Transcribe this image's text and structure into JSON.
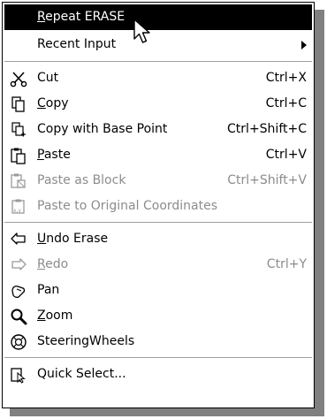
{
  "menu": {
    "repeat": {
      "label": "Repeat ERASE"
    },
    "recent_input": {
      "label": "Recent Input"
    },
    "cut": {
      "label": "Cut",
      "shortcut": "Ctrl+X",
      "icon": "scissors-icon"
    },
    "copy": {
      "label": "Copy",
      "shortcut": "Ctrl+C",
      "icon": "copy-icon"
    },
    "copy_base": {
      "label": "Copy with Base Point",
      "shortcut": "Ctrl+Shift+C",
      "icon": "copy-base-point-icon"
    },
    "paste": {
      "label": "Paste",
      "shortcut": "Ctrl+V",
      "icon": "paste-icon"
    },
    "paste_block": {
      "label": "Paste as Block",
      "shortcut": "Ctrl+Shift+V",
      "icon": "paste-block-icon"
    },
    "paste_orig": {
      "label": "Paste to Original Coordinates",
      "icon": "paste-coordinates-icon"
    },
    "undo": {
      "label": "Undo Erase",
      "icon": "undo-icon"
    },
    "redo": {
      "label": "Redo",
      "shortcut": "Ctrl+Y",
      "icon": "redo-icon"
    },
    "pan": {
      "label": "Pan",
      "icon": "pan-hand-icon"
    },
    "zoom": {
      "label": "Zoom",
      "icon": "zoom-icon"
    },
    "steering": {
      "label": "SteeringWheels",
      "icon": "steering-wheel-icon"
    },
    "quick_select": {
      "label": "Quick Select...",
      "icon": "quick-select-icon"
    }
  },
  "colors": {
    "highlight_bg": "#000000",
    "highlight_fg": "#ffffff",
    "disabled_fg": "#8c8c8c",
    "shadow": "#808080"
  }
}
